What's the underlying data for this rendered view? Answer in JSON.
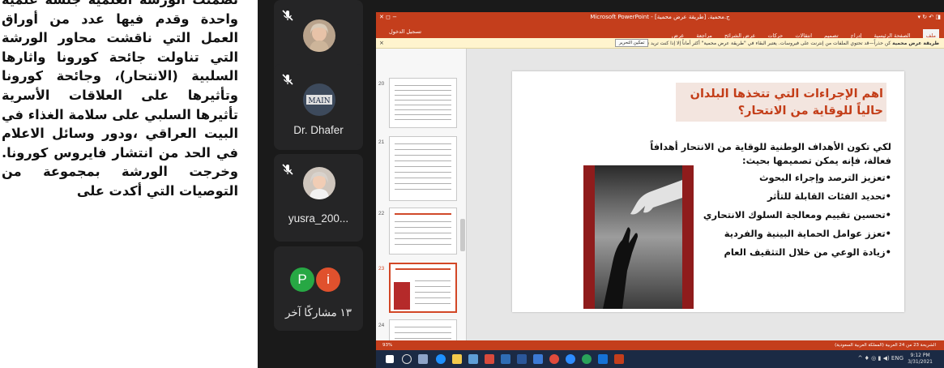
{
  "article": {
    "text": "تضمنت الورشة العلمية جلسة علمية واحدة وقدم فيها عدد من أوراق العمل التي ناقشت محاور الورشة التي تناولت جائحة كورونا واثارها السلبية (الانتحار)، وجائحة كورونا وتأثيرها على العلاقات الأسرية تأثيرها السلبي على سلامة الغذاء في البيت العراقي ،ودور وسائل الاعلام في الحد من انتشار فايروس كورونا. وخرجت الورشة بمجموعة من التوصيات التي أكدت على"
  },
  "zoom": {
    "participants": [
      {
        "name": "",
        "muted": true
      },
      {
        "name": "Dr. Dhafer",
        "muted": true
      },
      {
        "name": "yusra_200...",
        "muted": true
      }
    ],
    "others": {
      "label": "١٣ مشاركًا آخر",
      "badges": [
        {
          "letter": "P",
          "color": "#27a844"
        },
        {
          "letter": "i",
          "color": "#e0512d"
        }
      ]
    }
  },
  "ppt": {
    "window_title": "Microsoft PowerPoint - [طريقة عرض محمية] .ج.محمية",
    "tabs": [
      "الصفحة الرئيسية",
      "إدراج",
      "تصميم",
      "انتقالات",
      "حركات",
      "عرض الشرائح",
      "مراجعة",
      "عرض",
      "تسجيل الدخول"
    ],
    "active_tab": "ملف",
    "protected_view": {
      "label": "طريقة عرض محمية",
      "message": "كن حذراً—قد تحتوي الملفات من إنترنت على فيروسات. يعتبر البقاء في \"طريقة عرض محمية\" أكثر أماناً إلا إذا كنت تريد تحريرها.",
      "button": "تمكين التحرير"
    },
    "thumbnail_numbers": [
      "20",
      "21",
      "22",
      "23",
      "24"
    ],
    "slide": {
      "title": "اهم الإجراءات التي تتخذها البلدان حالياً للوقاية من الانتحار؟",
      "intro": "لكي تكون الأهداف الوطنية للوقاية من الانتحار أهدافاً فعالة، فإنه يمكن تصميمها بحيث:",
      "bullets": [
        "•تعزيز الترصد وإجراء البحوث",
        "•تحديد الفئات القابلة للتأثر",
        "•تحسين تقييم ومعالجة السلوك الانتحاري",
        "•تعزز عوامل الحماية البينية والفردية",
        "•زيادة الوعي من خلال التثقيف العام"
      ]
    },
    "status": {
      "left": "93%",
      "right": "الشريحة 23 من 24   العربية (المملكة العربية السعودية)"
    }
  },
  "taskbar": {
    "time": "9:12 PM",
    "date": "3/31/2021",
    "language": "ENG"
  }
}
